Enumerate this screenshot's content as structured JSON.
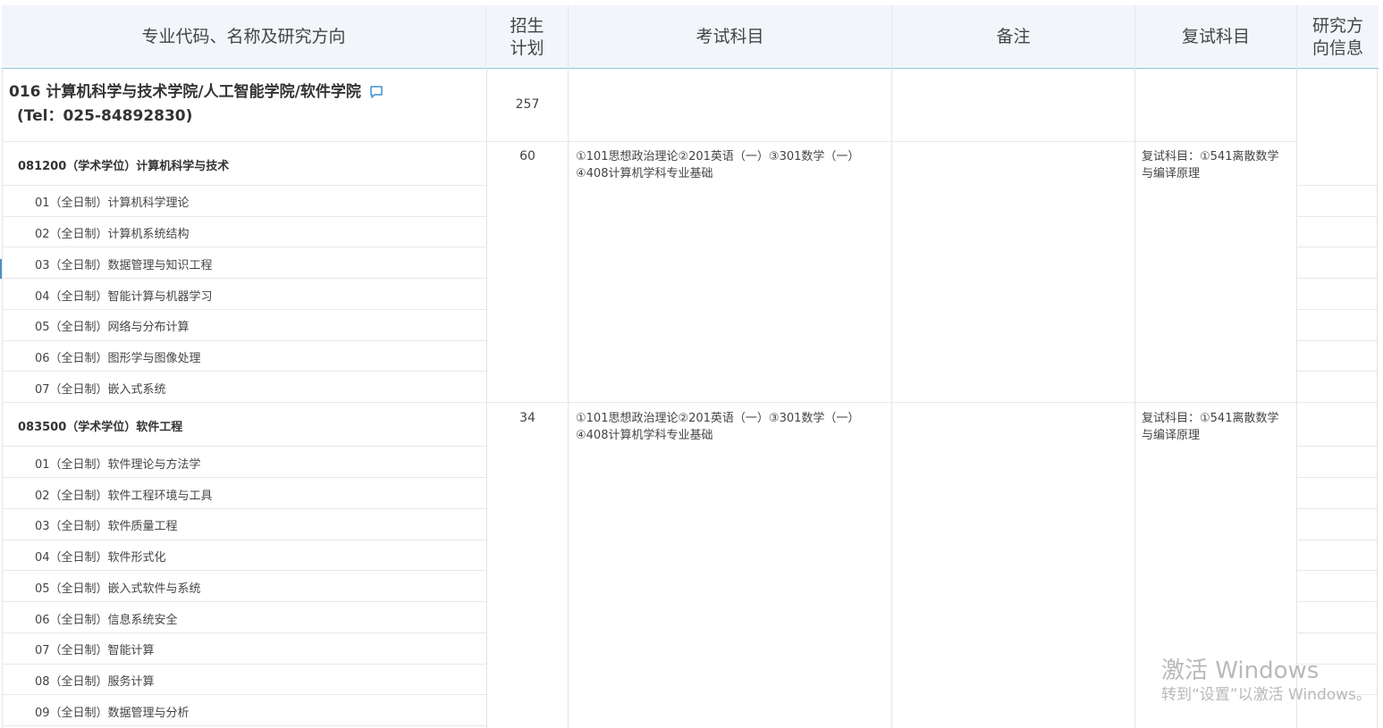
{
  "header": {
    "col1": "专业代码、名称及研究方向",
    "col2_line1": "招生",
    "col2_line2": "计划",
    "col3": "考试科目",
    "col4": "备注",
    "col5": "复试科目",
    "col6_line1": "研究方",
    "col6_line2": "向信息"
  },
  "college": {
    "name": "016 计算机科学与技术学院/人工智能学院/软件学院",
    "tel": "(Tel：025-84892830)",
    "plan": "257",
    "icon": "chat-bubble-icon"
  },
  "majors": [
    {
      "title": "081200（学术学位）计算机科学与技术",
      "plan": "60",
      "exam": "①101思想政治理论②201英语（一）③301数学（一）④408计算机学科专业基础",
      "retest": "复试科目：①541离散数学与编译原理",
      "directions": [
        "01（全日制）计算机科学理论",
        "02（全日制）计算机系统结构",
        "03（全日制）数据管理与知识工程",
        "04（全日制）智能计算与机器学习",
        "05（全日制）网络与分布计算",
        "06（全日制）图形学与图像处理",
        "07（全日制）嵌入式系统"
      ]
    },
    {
      "title": "083500（学术学位）软件工程",
      "plan": "34",
      "exam": "①101思想政治理论②201英语（一）③301数学（一）④408计算机学科专业基础",
      "retest": "复试科目：①541离散数学与编译原理",
      "directions": [
        "01（全日制）软件理论与方法学",
        "02（全日制）软件工程环境与工具",
        "03（全日制）软件质量工程",
        "04（全日制）软件形式化",
        "05（全日制）嵌入式软件与系统",
        "06（全日制）信息系统安全",
        "07（全日制）智能计算",
        "08（全日制）服务计算",
        "09（全日制）数据管理与分析"
      ]
    }
  ],
  "watermark": {
    "title": "激活 Windows",
    "subtitle": "转到“设置”以激活 Windows。"
  }
}
